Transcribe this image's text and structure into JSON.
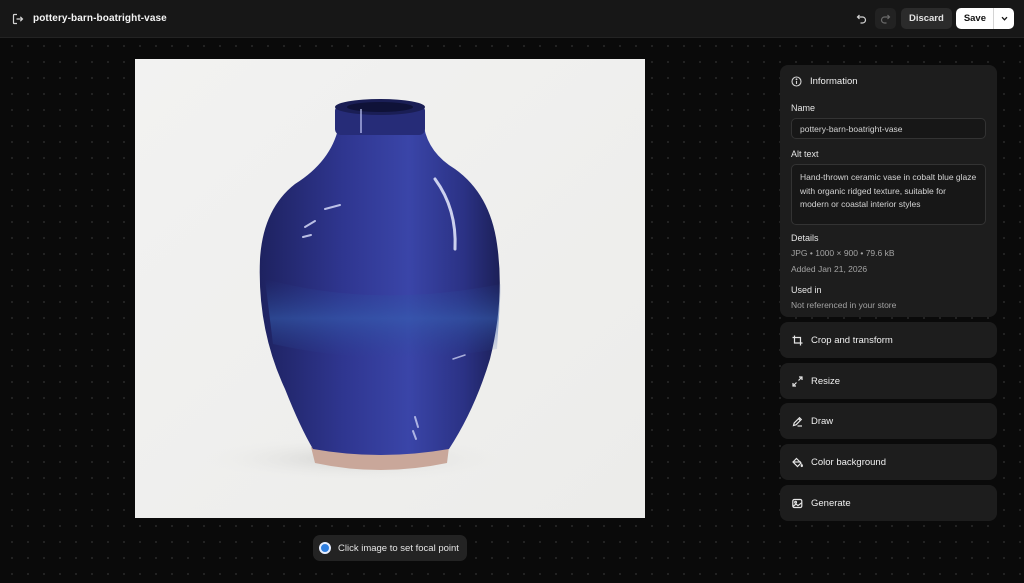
{
  "header": {
    "title": "pottery-barn-boatright-vase",
    "discard_label": "Discard",
    "save_label": "Save"
  },
  "canvas": {
    "focal_hint": "Click image to set focal point"
  },
  "info": {
    "heading": "Information",
    "name_label": "Name",
    "name_value": "pottery-barn-boatright-vase",
    "alt_label": "Alt text",
    "alt_value": "Hand-thrown ceramic vase in cobalt blue glaze with organic ridged texture, suitable for modern or coastal interior styles",
    "details_label": "Details",
    "details_meta": "JPG • 1000 × 900 • 79.6 kB",
    "details_added": "Added Jan 21, 2026",
    "used_in_label": "Used in",
    "used_in_value": "Not referenced in your store"
  },
  "actions": [
    {
      "label": "Crop and transform",
      "icon": "crop-icon"
    },
    {
      "label": "Resize",
      "icon": "resize-icon"
    },
    {
      "label": "Draw",
      "icon": "draw-icon"
    },
    {
      "label": "Color background",
      "icon": "paint-bucket-icon"
    },
    {
      "label": "Generate",
      "icon": "generate-icon"
    }
  ],
  "colors": {
    "background": "#0a0a0a",
    "panel": "#1d1d1d",
    "accent_blue": "#2f7fe0",
    "vase_glaze": "#2a2f78"
  }
}
